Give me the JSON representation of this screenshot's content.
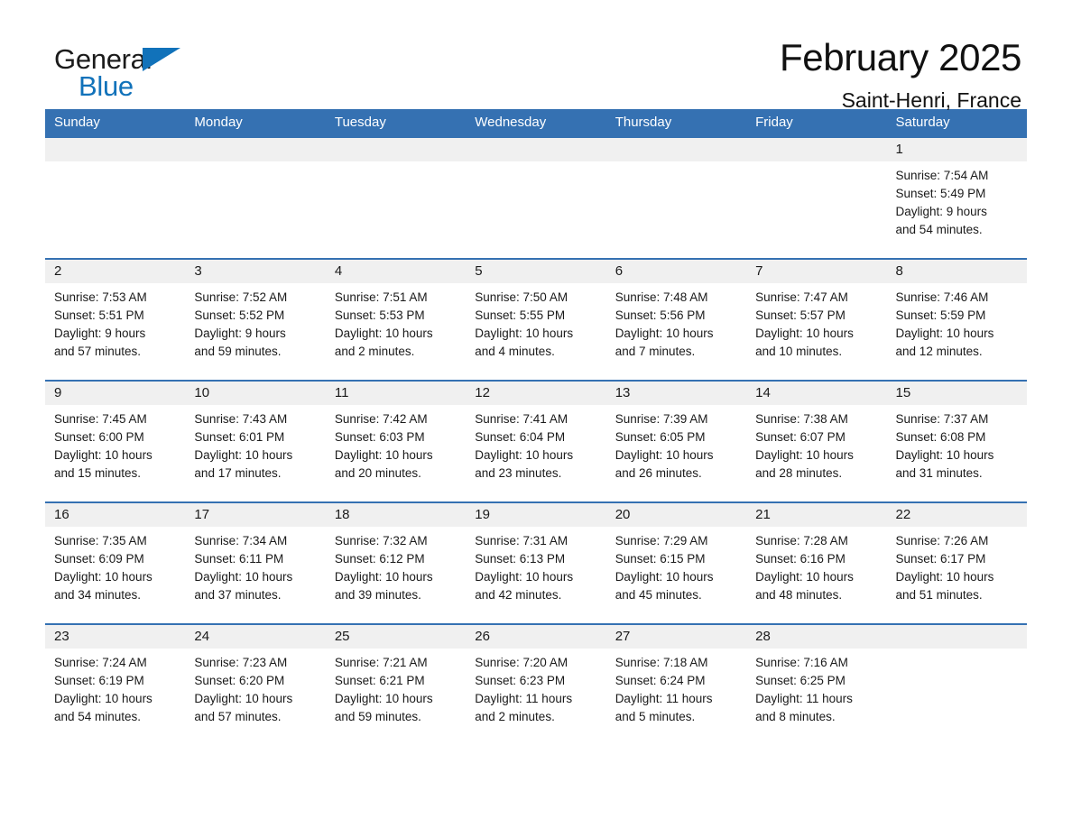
{
  "brand": {
    "name_part1": "General",
    "name_part2": "Blue",
    "accent_color": "#1172ba"
  },
  "header": {
    "month_title": "February 2025",
    "location": "Saint-Henri, France"
  },
  "theme": {
    "header_blue": "#3571b2",
    "daynum_band": "#f0f0f0"
  },
  "weekdays": [
    {
      "label": "Sunday"
    },
    {
      "label": "Monday"
    },
    {
      "label": "Tuesday"
    },
    {
      "label": "Wednesday"
    },
    {
      "label": "Thursday"
    },
    {
      "label": "Friday"
    },
    {
      "label": "Saturday"
    }
  ],
  "weeks": [
    {
      "days": [
        {
          "num": "",
          "empty": true,
          "l1": "",
          "l2": "",
          "l3": "",
          "l4": ""
        },
        {
          "num": "",
          "empty": true,
          "l1": "",
          "l2": "",
          "l3": "",
          "l4": ""
        },
        {
          "num": "",
          "empty": true,
          "l1": "",
          "l2": "",
          "l3": "",
          "l4": ""
        },
        {
          "num": "",
          "empty": true,
          "l1": "",
          "l2": "",
          "l3": "",
          "l4": ""
        },
        {
          "num": "",
          "empty": true,
          "l1": "",
          "l2": "",
          "l3": "",
          "l4": ""
        },
        {
          "num": "",
          "empty": true,
          "l1": "",
          "l2": "",
          "l3": "",
          "l4": ""
        },
        {
          "num": "1",
          "empty": false,
          "l1": "Sunrise: 7:54 AM",
          "l2": "Sunset: 5:49 PM",
          "l3": "Daylight: 9 hours",
          "l4": "and 54 minutes."
        }
      ]
    },
    {
      "days": [
        {
          "num": "2",
          "empty": false,
          "l1": "Sunrise: 7:53 AM",
          "l2": "Sunset: 5:51 PM",
          "l3": "Daylight: 9 hours",
          "l4": "and 57 minutes."
        },
        {
          "num": "3",
          "empty": false,
          "l1": "Sunrise: 7:52 AM",
          "l2": "Sunset: 5:52 PM",
          "l3": "Daylight: 9 hours",
          "l4": "and 59 minutes."
        },
        {
          "num": "4",
          "empty": false,
          "l1": "Sunrise: 7:51 AM",
          "l2": "Sunset: 5:53 PM",
          "l3": "Daylight: 10 hours",
          "l4": "and 2 minutes."
        },
        {
          "num": "5",
          "empty": false,
          "l1": "Sunrise: 7:50 AM",
          "l2": "Sunset: 5:55 PM",
          "l3": "Daylight: 10 hours",
          "l4": "and 4 minutes."
        },
        {
          "num": "6",
          "empty": false,
          "l1": "Sunrise: 7:48 AM",
          "l2": "Sunset: 5:56 PM",
          "l3": "Daylight: 10 hours",
          "l4": "and 7 minutes."
        },
        {
          "num": "7",
          "empty": false,
          "l1": "Sunrise: 7:47 AM",
          "l2": "Sunset: 5:57 PM",
          "l3": "Daylight: 10 hours",
          "l4": "and 10 minutes."
        },
        {
          "num": "8",
          "empty": false,
          "l1": "Sunrise: 7:46 AM",
          "l2": "Sunset: 5:59 PM",
          "l3": "Daylight: 10 hours",
          "l4": "and 12 minutes."
        }
      ]
    },
    {
      "days": [
        {
          "num": "9",
          "empty": false,
          "l1": "Sunrise: 7:45 AM",
          "l2": "Sunset: 6:00 PM",
          "l3": "Daylight: 10 hours",
          "l4": "and 15 minutes."
        },
        {
          "num": "10",
          "empty": false,
          "l1": "Sunrise: 7:43 AM",
          "l2": "Sunset: 6:01 PM",
          "l3": "Daylight: 10 hours",
          "l4": "and 17 minutes."
        },
        {
          "num": "11",
          "empty": false,
          "l1": "Sunrise: 7:42 AM",
          "l2": "Sunset: 6:03 PM",
          "l3": "Daylight: 10 hours",
          "l4": "and 20 minutes."
        },
        {
          "num": "12",
          "empty": false,
          "l1": "Sunrise: 7:41 AM",
          "l2": "Sunset: 6:04 PM",
          "l3": "Daylight: 10 hours",
          "l4": "and 23 minutes."
        },
        {
          "num": "13",
          "empty": false,
          "l1": "Sunrise: 7:39 AM",
          "l2": "Sunset: 6:05 PM",
          "l3": "Daylight: 10 hours",
          "l4": "and 26 minutes."
        },
        {
          "num": "14",
          "empty": false,
          "l1": "Sunrise: 7:38 AM",
          "l2": "Sunset: 6:07 PM",
          "l3": "Daylight: 10 hours",
          "l4": "and 28 minutes."
        },
        {
          "num": "15",
          "empty": false,
          "l1": "Sunrise: 7:37 AM",
          "l2": "Sunset: 6:08 PM",
          "l3": "Daylight: 10 hours",
          "l4": "and 31 minutes."
        }
      ]
    },
    {
      "days": [
        {
          "num": "16",
          "empty": false,
          "l1": "Sunrise: 7:35 AM",
          "l2": "Sunset: 6:09 PM",
          "l3": "Daylight: 10 hours",
          "l4": "and 34 minutes."
        },
        {
          "num": "17",
          "empty": false,
          "l1": "Sunrise: 7:34 AM",
          "l2": "Sunset: 6:11 PM",
          "l3": "Daylight: 10 hours",
          "l4": "and 37 minutes."
        },
        {
          "num": "18",
          "empty": false,
          "l1": "Sunrise: 7:32 AM",
          "l2": "Sunset: 6:12 PM",
          "l3": "Daylight: 10 hours",
          "l4": "and 39 minutes."
        },
        {
          "num": "19",
          "empty": false,
          "l1": "Sunrise: 7:31 AM",
          "l2": "Sunset: 6:13 PM",
          "l3": "Daylight: 10 hours",
          "l4": "and 42 minutes."
        },
        {
          "num": "20",
          "empty": false,
          "l1": "Sunrise: 7:29 AM",
          "l2": "Sunset: 6:15 PM",
          "l3": "Daylight: 10 hours",
          "l4": "and 45 minutes."
        },
        {
          "num": "21",
          "empty": false,
          "l1": "Sunrise: 7:28 AM",
          "l2": "Sunset: 6:16 PM",
          "l3": "Daylight: 10 hours",
          "l4": "and 48 minutes."
        },
        {
          "num": "22",
          "empty": false,
          "l1": "Sunrise: 7:26 AM",
          "l2": "Sunset: 6:17 PM",
          "l3": "Daylight: 10 hours",
          "l4": "and 51 minutes."
        }
      ]
    },
    {
      "days": [
        {
          "num": "23",
          "empty": false,
          "l1": "Sunrise: 7:24 AM",
          "l2": "Sunset: 6:19 PM",
          "l3": "Daylight: 10 hours",
          "l4": "and 54 minutes."
        },
        {
          "num": "24",
          "empty": false,
          "l1": "Sunrise: 7:23 AM",
          "l2": "Sunset: 6:20 PM",
          "l3": "Daylight: 10 hours",
          "l4": "and 57 minutes."
        },
        {
          "num": "25",
          "empty": false,
          "l1": "Sunrise: 7:21 AM",
          "l2": "Sunset: 6:21 PM",
          "l3": "Daylight: 10 hours",
          "l4": "and 59 minutes."
        },
        {
          "num": "26",
          "empty": false,
          "l1": "Sunrise: 7:20 AM",
          "l2": "Sunset: 6:23 PM",
          "l3": "Daylight: 11 hours",
          "l4": "and 2 minutes."
        },
        {
          "num": "27",
          "empty": false,
          "l1": "Sunrise: 7:18 AM",
          "l2": "Sunset: 6:24 PM",
          "l3": "Daylight: 11 hours",
          "l4": "and 5 minutes."
        },
        {
          "num": "28",
          "empty": false,
          "l1": "Sunrise: 7:16 AM",
          "l2": "Sunset: 6:25 PM",
          "l3": "Daylight: 11 hours",
          "l4": "and 8 minutes."
        },
        {
          "num": "",
          "empty": true,
          "l1": "",
          "l2": "",
          "l3": "",
          "l4": ""
        }
      ]
    }
  ]
}
